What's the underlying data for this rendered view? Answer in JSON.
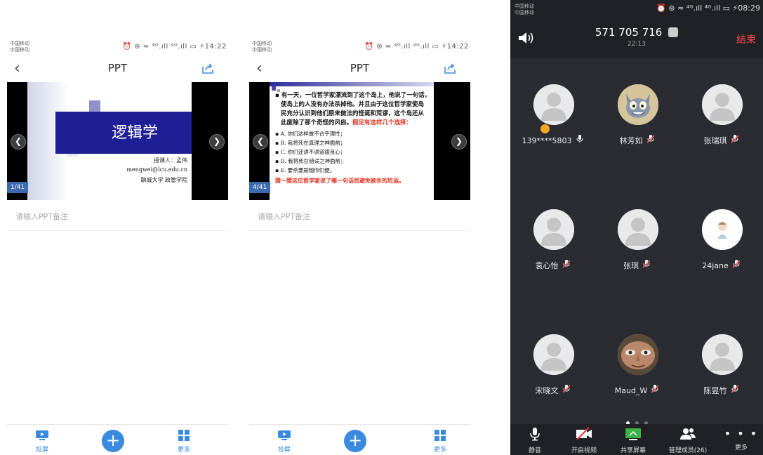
{
  "ppt_screens": [
    {
      "status": {
        "carrier1": "中国移动",
        "carrier2": "中国移动",
        "right": "⏰ ⊛ ≈ ⁴ᴳ.ıll ⁴ᴳ.ıll ▭ ⚡14:22"
      },
      "title": "PPT",
      "page": "1/41",
      "notes_placeholder": "请输入PPT备注",
      "bottom": {
        "cast": "投屏",
        "more": "更多"
      },
      "slide": {
        "title": "逻辑学",
        "lecturer": "授课人：孟伟",
        "email": "mengwei@lcu.edu.cn",
        "school": "聊城大学  政管学院"
      }
    },
    {
      "status": {
        "carrier1": "中国移动",
        "carrier2": "中国移动",
        "right": "⏰ ⊛ ≈ ⁴ᴳ.ıll ⁴ᴳ.ıll ▭ ⚡14:22"
      },
      "title": "PPT",
      "page": "4/41",
      "notes_placeholder": "请输入PPT备注",
      "bottom": {
        "cast": "投屏",
        "more": "更多"
      },
      "slide": {
        "line1": "▪ 有一天，一位哲学家漂流到了这个岛上，他说了一句话，",
        "line2": "使岛上的人没有办法杀掉他。并且由于这位哲学家使岛",
        "line3": "民充分认识到他们原来做法的怪诞和荒谬，这个岛还从",
        "line4a": "此废除了那个奇怪的风俗。",
        "line4b": "假定有这样几个选择：",
        "options": [
          "▪ A. 你们这样做不合乎理性；",
          "▪ B. 我将死在真理之神面前；",
          "▪ C. 你们还讲不讲道德良心；",
          "▪ D. 我将死在错误之神面前；",
          "▪ E. 要杀要剐随你们便。"
        ],
        "question": "猜一猜这位哲学家说了哪一句话而避免被杀的厄运。"
      }
    }
  ],
  "meeting": {
    "status": {
      "carrier1": "中国移动",
      "carrier2": "中国移动",
      "right": "⏰ ⊛ ≈ ⁴ᴳ.ıll ⁴ᴳ.ıll ▭ ⚡08:29"
    },
    "meeting_id": "571 705 716",
    "duration": "22:13",
    "end_label": "结束",
    "participants": [
      {
        "name": "139****5803",
        "mic": "on",
        "avatar": "default",
        "host": true
      },
      {
        "name": "林芳如",
        "mic": "muted",
        "avatar": "cartoon-cat",
        "host": false
      },
      {
        "name": "张瑞琪",
        "mic": "muted",
        "avatar": "default",
        "host": false
      },
      {
        "name": "袁心怡",
        "mic": "muted",
        "avatar": "default",
        "host": false
      },
      {
        "name": "张琪",
        "mic": "muted",
        "avatar": "default",
        "host": false
      },
      {
        "name": "24jane",
        "mic": "muted",
        "avatar": "cartoon-figure",
        "host": false
      },
      {
        "name": "宋晓文",
        "mic": "muted",
        "avatar": "default",
        "host": false
      },
      {
        "name": "Maud_W",
        "mic": "muted",
        "avatar": "photo-face",
        "host": false
      },
      {
        "name": "陈昱竹",
        "mic": "muted",
        "avatar": "default",
        "host": false
      }
    ],
    "toolbar": {
      "mute": "静音",
      "video": "开启视频",
      "share": "共享屏幕",
      "members": "管理成员(26)",
      "more": "更多"
    },
    "colors": {
      "background": "#2a2c31",
      "end": "#ff4a4a",
      "accent": "#3a8ae0"
    }
  }
}
